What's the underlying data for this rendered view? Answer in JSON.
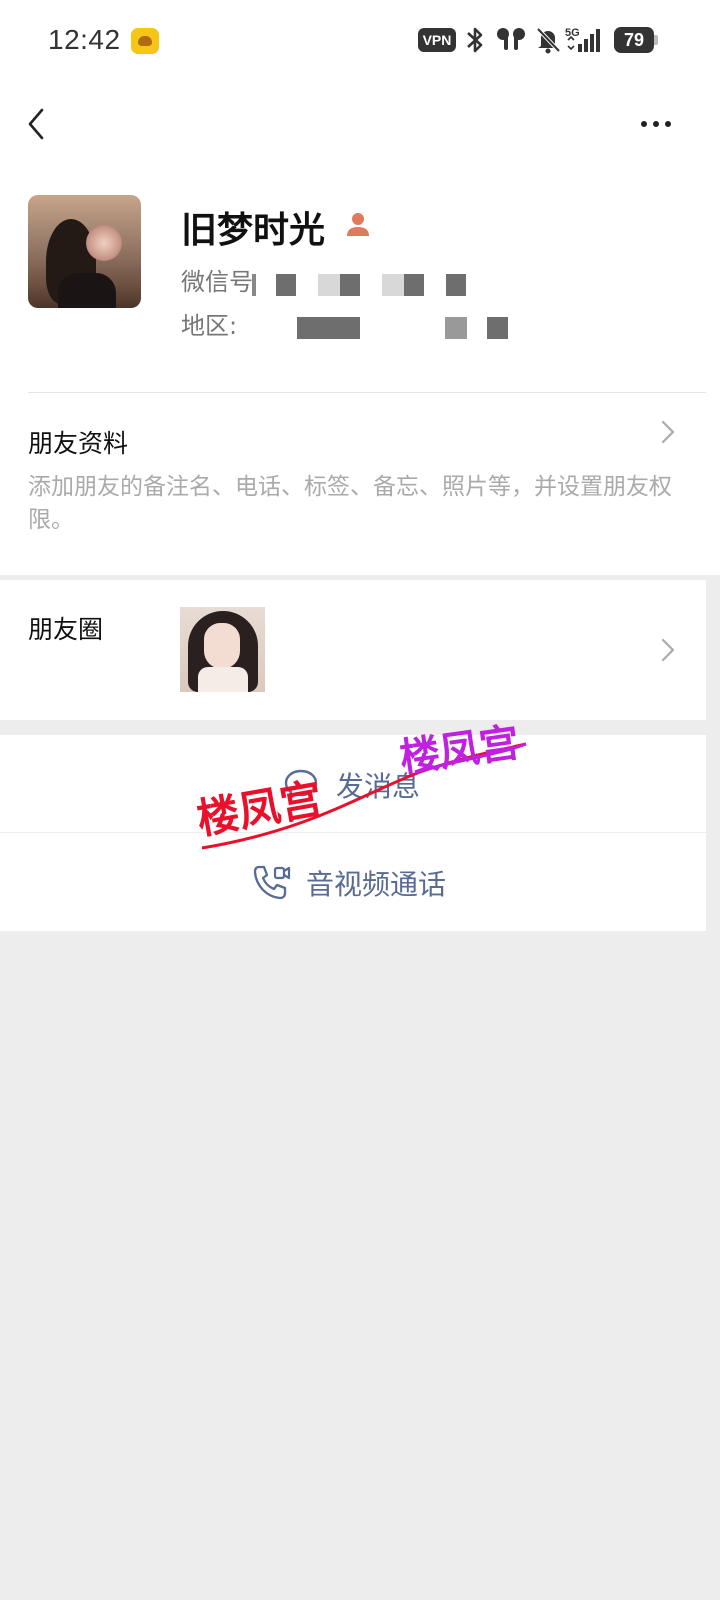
{
  "status_bar": {
    "time": "12:42",
    "vpn": "VPN",
    "network": "5G",
    "battery": "79"
  },
  "profile": {
    "name": "旧梦时光",
    "wechat_id_label": "微信号",
    "region_label": "地区:"
  },
  "friend_info": {
    "title": "朋友资料",
    "description": "添加朋友的备注名、电话、标签、备忘、照片等，并设置朋友权限。"
  },
  "moments": {
    "title": "朋友圈"
  },
  "actions": {
    "send_message": "发消息",
    "av_call": "音视频通话"
  },
  "watermark": {
    "text_1": "楼凤宫",
    "text_2": "楼凤宫"
  },
  "colors": {
    "link": "#576b95",
    "background": "#ededed",
    "watermark_red": "#e8102a",
    "watermark_purple": "#c020e0"
  }
}
